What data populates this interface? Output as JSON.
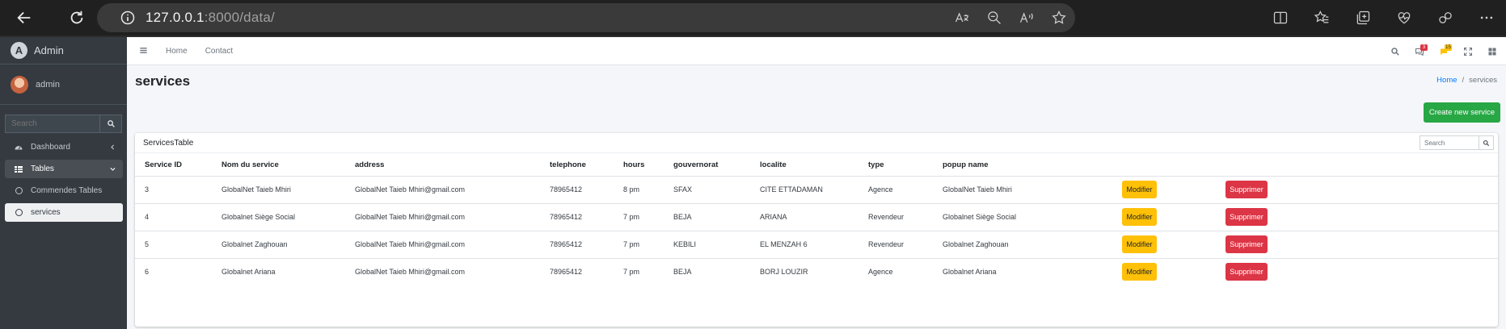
{
  "browser": {
    "url_host": "127.0.0.1",
    "url_rest": ":8000/data/"
  },
  "sidebar": {
    "brand_logo": "A",
    "brand": "Admin",
    "user": "admin",
    "search_placeholder": "Search",
    "items": [
      {
        "label": "Dashboard"
      },
      {
        "label": "Tables"
      },
      {
        "label": "Commendes Tables"
      },
      {
        "label": "services"
      }
    ]
  },
  "topnav": {
    "links": [
      "Home",
      "Contact"
    ],
    "messages_badge": "3",
    "notifications_badge": "15",
    "colors": {
      "danger": "#dc3545",
      "warning": "#ffc107"
    }
  },
  "page": {
    "title": "services",
    "breadcrumb": {
      "home": "Home",
      "sep": "/",
      "current": "services"
    },
    "create_button": "Create new service"
  },
  "card": {
    "title": "ServicesTable",
    "search_placeholder": "Search"
  },
  "table": {
    "headers": [
      "Service ID",
      "Nom du service",
      "address",
      "telephone",
      "hours",
      "gouvernorat",
      "localite",
      "type",
      "popup name"
    ],
    "rows": [
      {
        "id": "3",
        "name": "GlobalNet Taieb Mhiri",
        "address": "GlobalNet Taieb Mhiri@gmail.com",
        "telephone": "78965412",
        "hours": "8 pm",
        "gouvernorat": "SFAX",
        "localite": "CITE ETTADAMAN",
        "type": "Agence",
        "popup": "GlobalNet Taieb Mhiri"
      },
      {
        "id": "4",
        "name": "Globalnet Siège Social",
        "address": "GlobalNet Taieb Mhiri@gmail.com",
        "telephone": "78965412",
        "hours": "7 pm",
        "gouvernorat": "BEJA",
        "localite": "ARIANA",
        "type": "Revendeur",
        "popup": "Globalnet Siège Social"
      },
      {
        "id": "5",
        "name": "Globalnet Zaghouan",
        "address": "GlobalNet Taieb Mhiri@gmail.com",
        "telephone": "78965412",
        "hours": "7 pm",
        "gouvernorat": "KEBILI",
        "localite": "EL MENZAH 6",
        "type": "Revendeur",
        "popup": "Globalnet Zaghouan"
      },
      {
        "id": "6",
        "name": "Globalnet Ariana",
        "address": "GlobalNet Taieb Mhiri@gmail.com",
        "telephone": "78965412",
        "hours": "7 pm",
        "gouvernorat": "BEJA",
        "localite": "BORJ LOUZIR",
        "type": "Agence",
        "popup": "Globalnet Ariana"
      }
    ],
    "modify_label": "Modifier",
    "delete_label": "Supprimer"
  },
  "colors": {
    "sidebar_bg": "#343a40",
    "success": "#28a745",
    "warning": "#ffc107",
    "danger": "#dc3545",
    "link": "#007bff"
  }
}
